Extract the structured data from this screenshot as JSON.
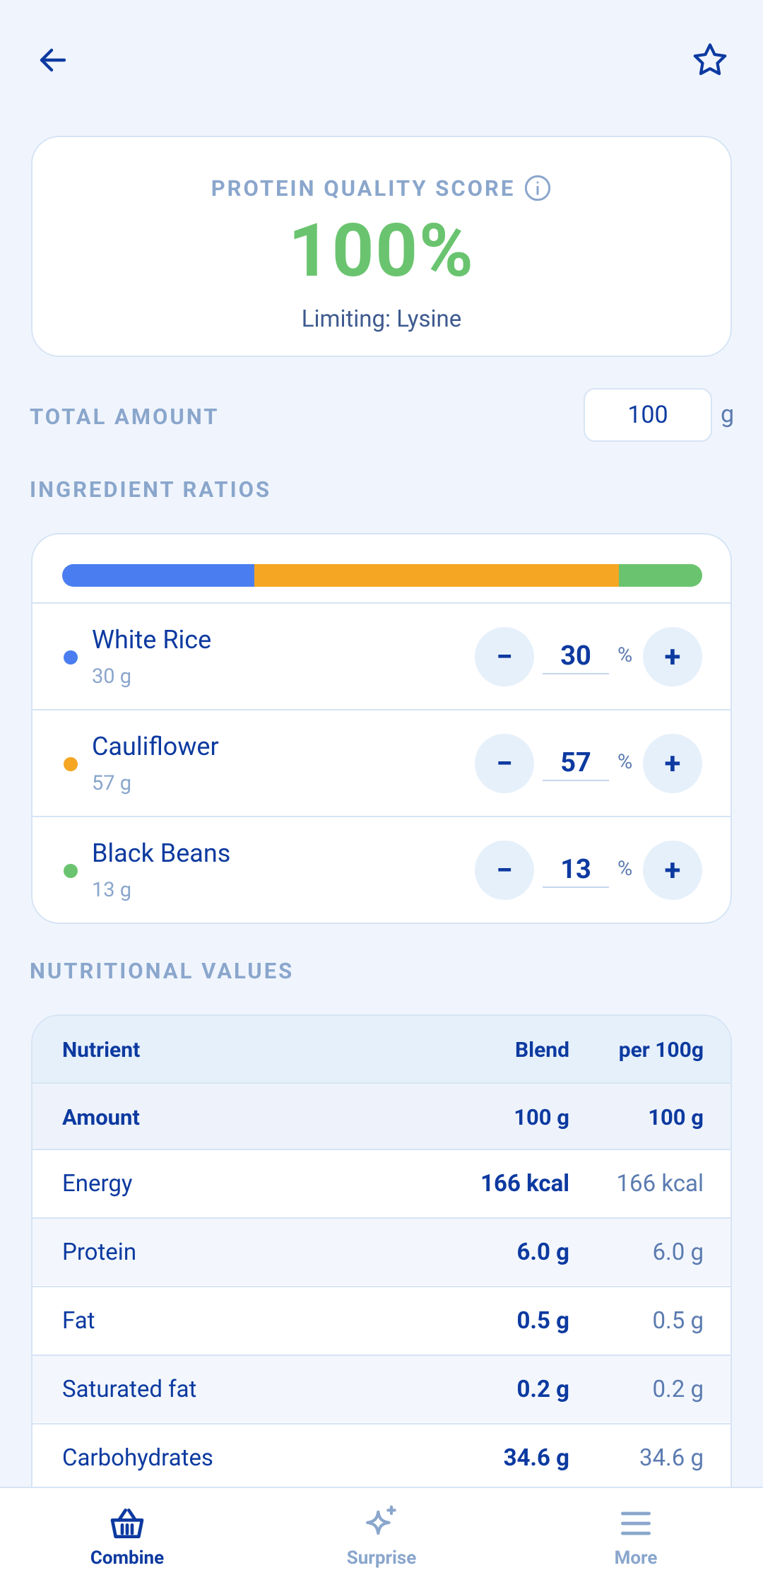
{
  "colors": {
    "primary": "#0d3aa0",
    "score_green": "#6ac46f",
    "rice": "#4a7ef0",
    "cauliflower": "#f5a623",
    "beans": "#6ac46f",
    "muted": "#8aa6cc"
  },
  "header": {
    "back_icon": "arrow-left-icon",
    "favorite_icon": "star-outline-icon"
  },
  "score": {
    "label": "PROTEIN QUALITY SCORE",
    "info_icon": "info-icon",
    "value": "100%",
    "limiting": "Limiting: Lysine"
  },
  "total": {
    "label": "TOTAL AMOUNT",
    "value": "100",
    "unit": "g"
  },
  "ratios": {
    "title": "INGREDIENT RATIOS",
    "ingredients": [
      {
        "name": "White Rice",
        "grams": "30 g",
        "percent": "30",
        "pct_symbol": "%",
        "minus": "−",
        "plus": "+",
        "color": "#4a7ef0",
        "share": 30
      },
      {
        "name": "Cauliflower",
        "grams": "57 g",
        "percent": "57",
        "pct_symbol": "%",
        "minus": "−",
        "plus": "+",
        "color": "#f5a623",
        "share": 57
      },
      {
        "name": "Black Beans",
        "grams": "13 g",
        "percent": "13",
        "pct_symbol": "%",
        "minus": "−",
        "plus": "+",
        "color": "#6ac46f",
        "share": 13
      }
    ]
  },
  "nutrition": {
    "title": "NUTRITIONAL VALUES",
    "headers": {
      "name": "Nutrient",
      "blend": "Blend",
      "per": "per 100g"
    },
    "amount": {
      "name": "Amount",
      "blend": "100 g",
      "per": "100 g"
    },
    "rows": [
      {
        "name": "Energy",
        "blend": "166 kcal",
        "per": "166 kcal"
      },
      {
        "name": "Protein",
        "blend": "6.0 g",
        "per": "6.0 g"
      },
      {
        "name": "Fat",
        "blend": "0.5 g",
        "per": "0.5 g"
      },
      {
        "name": "Saturated fat",
        "blend": "0.2 g",
        "per": "0.2 g"
      },
      {
        "name": "Carbohydrates",
        "blend": "34.6 g",
        "per": "34.6 g"
      }
    ]
  },
  "nav": {
    "items": [
      {
        "label": "Combine",
        "icon": "basket-icon",
        "active": true
      },
      {
        "label": "Surprise",
        "icon": "sparkle-icon",
        "active": false
      },
      {
        "label": "More",
        "icon": "menu-icon",
        "active": false
      }
    ]
  }
}
